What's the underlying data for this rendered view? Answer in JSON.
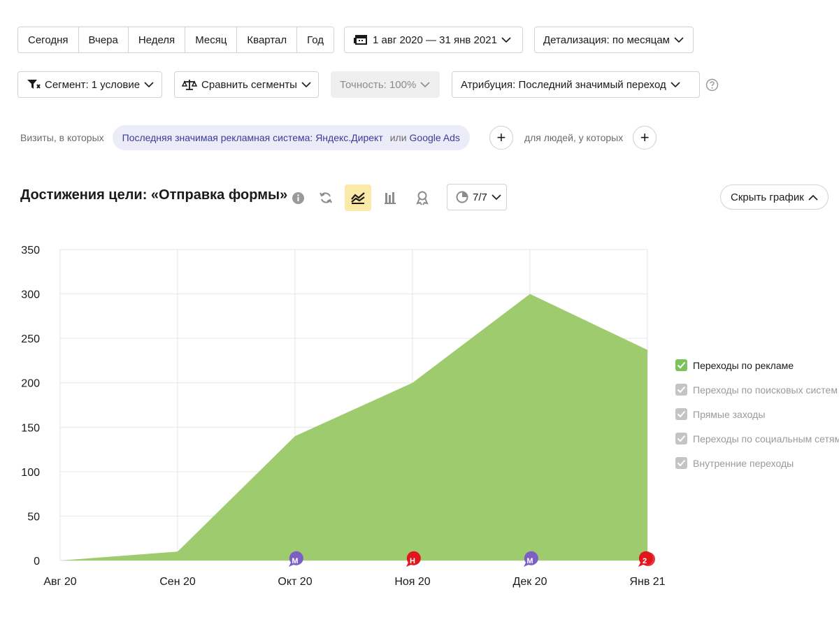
{
  "periods": [
    "Сегодня",
    "Вчера",
    "Неделя",
    "Месяц",
    "Квартал",
    "Год"
  ],
  "date_range": "1 авг 2020 — 31 янв 2021",
  "detail": "Детализация: по месяцам",
  "segment": "Сегмент: 1 условие",
  "compare": "Сравнить сегменты",
  "accuracy": "Точность: 100%",
  "attribution": "Атрибуция: Последний значимый переход",
  "filter": {
    "prefix": "Визиты, в которых",
    "chip_main": "Последняя значимая рекламная система: Яндекс.Директ",
    "chip_or": "или",
    "chip_second": "Google Ads",
    "people": "для людей, у которых",
    "plus": "+"
  },
  "chart_title": "Достижения цели: «Отправка формы»",
  "series_count": "7/7",
  "hide_chart": "Скрыть график",
  "legend": [
    {
      "label": "Переходы по рекламе",
      "checked": true,
      "color": "#7cc35a"
    },
    {
      "label": "Переходы по поисковых систем",
      "checked": true,
      "color": "#c4c4c4"
    },
    {
      "label": "Прямые заходы",
      "checked": true,
      "color": "#c4c4c4"
    },
    {
      "label": "Переходы по социальным сетям",
      "checked": true,
      "color": "#c4c4c4"
    },
    {
      "label": "Внутренние переходы",
      "checked": true,
      "color": "#c4c4c4"
    }
  ],
  "chart_data": {
    "type": "area",
    "categories": [
      "Авг 20",
      "Сен 20",
      "Окт 20",
      "Ноя 20",
      "Дек 20",
      "Янв 21"
    ],
    "series": [
      {
        "name": "Переходы по рекламе",
        "values": [
          0,
          10,
          140,
          200,
          300,
          237
        ],
        "color": "#9dcb6e"
      }
    ],
    "ylim": [
      0,
      350
    ],
    "yticks": [
      0,
      50,
      100,
      150,
      200,
      250,
      300,
      350
    ],
    "grid": true,
    "legend": "right",
    "markers": [
      {
        "category": "Окт 20",
        "label": "M",
        "color": "#7b5fc7"
      },
      {
        "category": "Ноя 20",
        "label": "Н",
        "color": "#e0161c"
      },
      {
        "category": "Дек 20",
        "label": "M",
        "color": "#7b5fc7"
      },
      {
        "category": "Янв 21",
        "label": "2",
        "color": "#e0161c"
      }
    ]
  }
}
